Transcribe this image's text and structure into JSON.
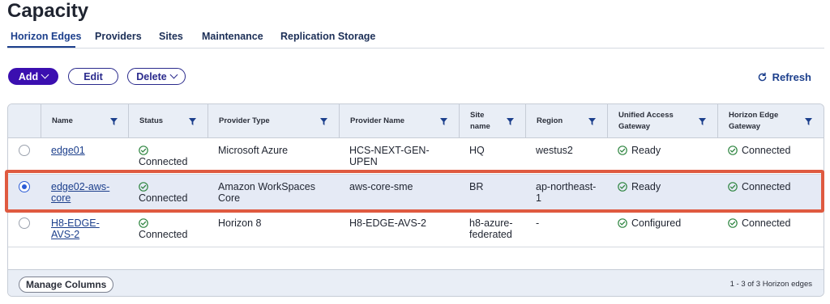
{
  "page_title": "Capacity",
  "tabs": [
    {
      "label": "Horizon Edges",
      "active": true
    },
    {
      "label": "Providers",
      "active": false
    },
    {
      "label": "Sites",
      "active": false
    },
    {
      "label": "Maintenance",
      "active": false
    },
    {
      "label": "Replication Storage",
      "active": false
    }
  ],
  "toolbar": {
    "add_label": "Add",
    "edit_label": "Edit",
    "delete_label": "Delete",
    "refresh_label": "Refresh"
  },
  "table": {
    "columns": [
      {
        "label": "Name"
      },
      {
        "label": "Status"
      },
      {
        "label": "Provider Type"
      },
      {
        "label": "Provider Name"
      },
      {
        "label": "Site name"
      },
      {
        "label": "Region"
      },
      {
        "label": "Unified Access Gateway"
      },
      {
        "label": "Horizon Edge Gateway"
      }
    ],
    "rows": [
      {
        "selected": false,
        "name": "edge01",
        "status": "Connected",
        "provider_type": "Microsoft Azure",
        "provider_name": "HCS-NEXT-GEN-UPEN",
        "site": "HQ",
        "region": "westus2",
        "uag": "Ready",
        "heg": "Connected"
      },
      {
        "selected": true,
        "name": "edge02-aws-core",
        "status": "Connected",
        "provider_type": "Amazon WorkSpaces Core",
        "provider_name": "aws-core-sme",
        "site": "BR",
        "region": "ap-northeast-1",
        "uag": "Ready",
        "heg": "Connected"
      },
      {
        "selected": false,
        "name": "H8-EDGE-AVS-2",
        "status": "Connected",
        "provider_type": "Horizon 8",
        "provider_name": "H8-EDGE-AVS-2",
        "site": "h8-azure-federated",
        "region": "-",
        "uag": "Configured",
        "heg": "Connected"
      }
    ]
  },
  "footer": {
    "manage_columns_label": "Manage Columns",
    "count_text": "1 - 3 of 3 Horizon edges"
  },
  "colors": {
    "primary": "#3b0fb0",
    "link": "#1c3f8c",
    "success": "#2e8540",
    "highlight": "#df5a40",
    "header_bg": "#e9eef6",
    "selected_row_bg": "#e5eaf5"
  }
}
